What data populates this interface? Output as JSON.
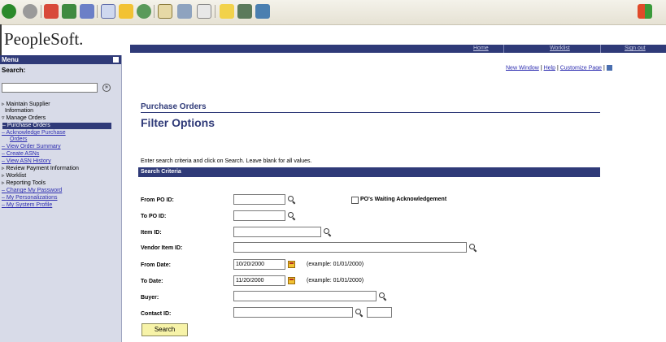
{
  "app": {
    "logo": "PeopleSoft."
  },
  "topnav": {
    "home": "Home",
    "worklist": "Worklist",
    "signout": "Sign out"
  },
  "utility": {
    "new_window": "New Window",
    "help": "Help",
    "customize": "Customize Page"
  },
  "menu": {
    "title": "Menu",
    "search_label": "Search:",
    "search_value": "",
    "items": [
      {
        "label": "Maintain Supplier"
      },
      {
        "label": "Information"
      },
      {
        "label": "Manage Orders"
      },
      {
        "label": "Purchase Orders"
      },
      {
        "label": "Acknowledge Purchase"
      },
      {
        "label": "Orders"
      },
      {
        "label": "View Order Summary"
      },
      {
        "label": "Create ASNs"
      },
      {
        "label": "View ASN History"
      },
      {
        "label": "Review Payment Information"
      },
      {
        "label": "Worklist"
      },
      {
        "label": "Reporting Tools"
      },
      {
        "label": "Change My Password"
      },
      {
        "label": "My Personalizations"
      },
      {
        "label": "My System Profile"
      }
    ]
  },
  "main": {
    "breadcrumb": "Purchase Orders",
    "title": "Filter Options",
    "instructions": "Enter search criteria and click on Search. Leave blank for all values.",
    "criteria_header": "Search Criteria",
    "fields": {
      "from_po": {
        "label": "From PO ID:",
        "value": ""
      },
      "to_po": {
        "label": "To PO ID:",
        "value": ""
      },
      "item": {
        "label": "Item ID:",
        "value": ""
      },
      "vendor_item": {
        "label": "Vendor Item ID:",
        "value": ""
      },
      "from_date": {
        "label": "From Date:",
        "value": "10/20/2000",
        "example": "(example: 01/01/2000)"
      },
      "to_date": {
        "label": "To Date:",
        "value": "11/20/2000",
        "example": "(example: 01/01/2000)"
      },
      "buyer": {
        "label": "Buyer:",
        "value": ""
      },
      "contact": {
        "label": "Contact ID:",
        "value": "",
        "extra": ""
      }
    },
    "po_waiting_label": "PO's Waiting Acknowledgement",
    "search_button": "Search"
  }
}
